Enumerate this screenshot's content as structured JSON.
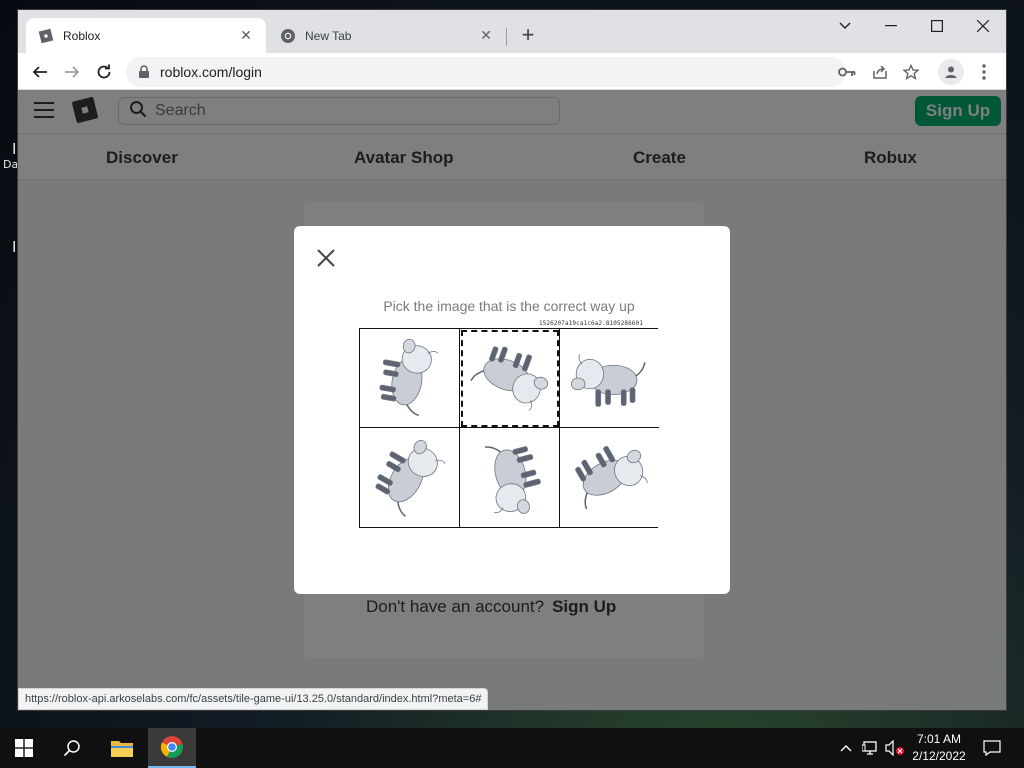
{
  "desktop": {
    "frag_a": "I",
    "frag_b": "Da",
    "frag_c": "I"
  },
  "browser": {
    "tabs": [
      {
        "title": "Roblox",
        "favicon": "roblox-favicon",
        "active": true
      },
      {
        "title": "New Tab",
        "favicon": "chrome-favicon",
        "active": false
      }
    ],
    "url": "roblox.com/login",
    "status_url": "https://roblox-api.arkoselabs.com/fc/assets/tile-game-ui/13.25.0/standard/index.html?meta=6#"
  },
  "roblox": {
    "search_placeholder": "Search",
    "signup_button": "Sign Up",
    "nav": [
      "Discover",
      "Avatar Shop",
      "Create",
      "Robux"
    ],
    "no_account_text": "Don't have an account?",
    "signup_link": "Sign Up",
    "brand_color": "#00b06f"
  },
  "captcha": {
    "prompt": "Pick the image that is the correct way up",
    "token": "1526207a19ca1c6a2.8105286601",
    "tiles": [
      {
        "subject": "bison",
        "rotation_deg": 100
      },
      {
        "subject": "bison",
        "rotation_deg": 200,
        "focused": true
      },
      {
        "subject": "bison",
        "rotation_deg": 0
      },
      {
        "subject": "bison",
        "rotation_deg": 120
      },
      {
        "subject": "bison",
        "rotation_deg": 255
      },
      {
        "subject": "bison",
        "rotation_deg": 150
      }
    ]
  },
  "taskbar": {
    "time": "7:01 AM",
    "date": "2/12/2022",
    "accent": "#76b9ed"
  }
}
